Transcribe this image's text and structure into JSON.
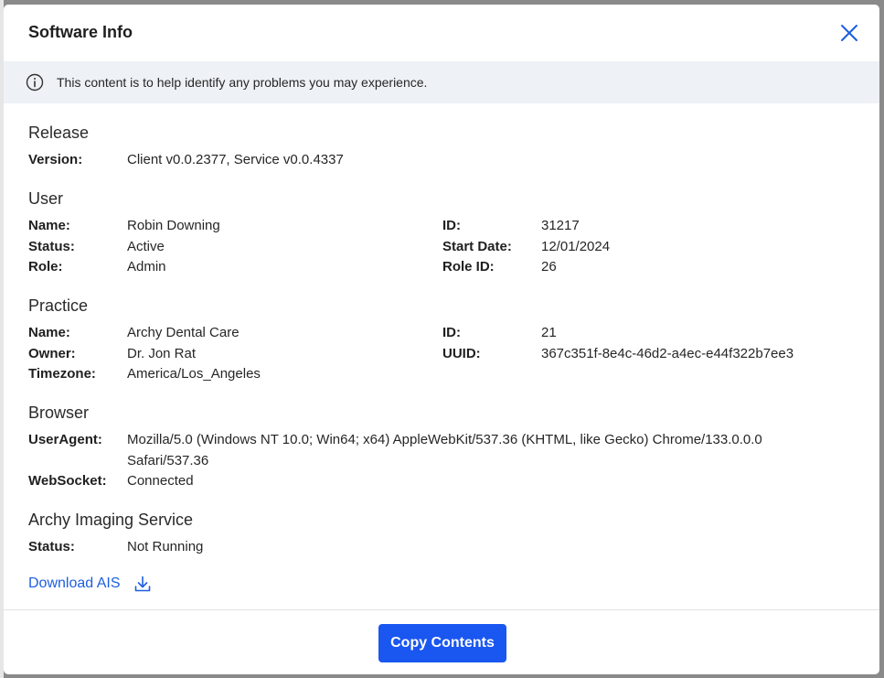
{
  "modal": {
    "title": "Software Info",
    "banner_text": "This content is to help identify any problems you may experience."
  },
  "release": {
    "heading": "Release",
    "version_label": "Version:",
    "version_value": "Client v0.0.2377, Service v0.0.4337"
  },
  "user": {
    "heading": "User",
    "name_label": "Name:",
    "name_value": "Robin Downing",
    "status_label": "Status:",
    "status_value": "Active",
    "role_label": "Role:",
    "role_value": "Admin",
    "id_label": "ID:",
    "id_value": "31217",
    "start_date_label": "Start Date:",
    "start_date_value": "12/01/2024",
    "role_id_label": "Role ID:",
    "role_id_value": "26"
  },
  "practice": {
    "heading": "Practice",
    "name_label": "Name:",
    "name_value": "Archy Dental Care",
    "owner_label": "Owner:",
    "owner_value": "Dr. Jon Rat",
    "timezone_label": "Timezone:",
    "timezone_value": "America/Los_Angeles",
    "id_label": "ID:",
    "id_value": "21",
    "uuid_label": "UUID:",
    "uuid_value": "367c351f-8e4c-46d2-a4ec-e44f322b7ee3"
  },
  "browser": {
    "heading": "Browser",
    "useragent_label": "UserAgent:",
    "useragent_value": "Mozilla/5.0 (Windows NT 10.0; Win64; x64) AppleWebKit/537.36 (KHTML, like Gecko) Chrome/133.0.0.0 Safari/537.36",
    "websocket_label": "WebSocket:",
    "websocket_value": "Connected"
  },
  "imaging": {
    "heading": "Archy Imaging Service",
    "status_label": "Status:",
    "status_value": "Not Running",
    "download_label": "Download AIS"
  },
  "footer": {
    "copy_label": "Copy Contents"
  },
  "icons": {
    "close": "close-icon",
    "info": "info-icon",
    "download": "download-icon"
  },
  "colors": {
    "accent": "#1a56f0",
    "link": "#1d5fe0",
    "banner_bg": "#eef1f5"
  }
}
